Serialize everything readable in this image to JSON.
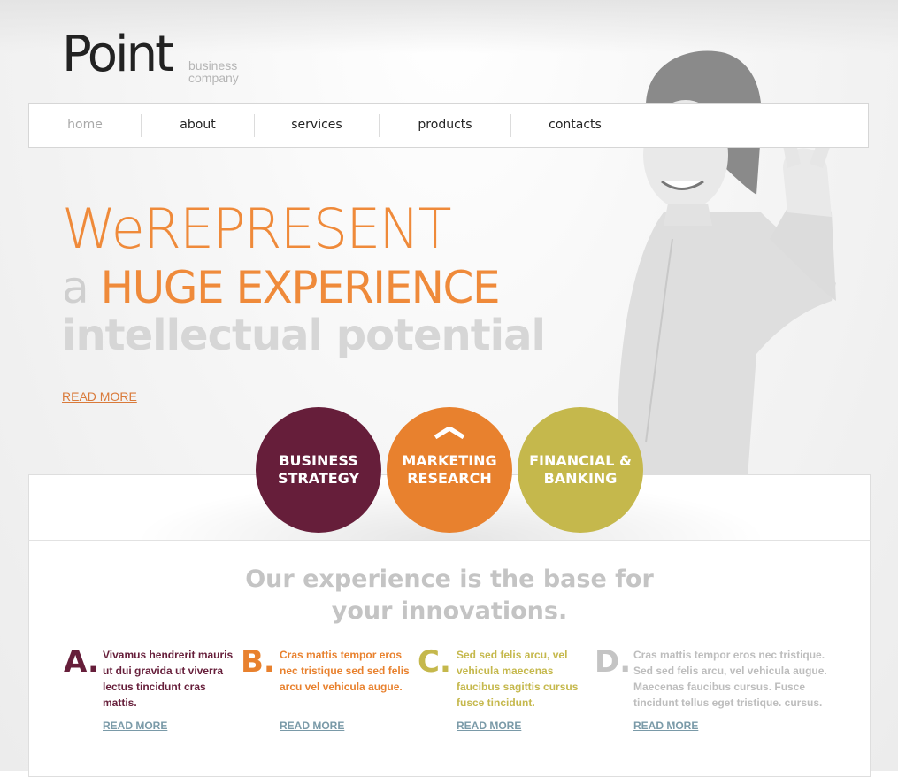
{
  "logo": {
    "word": "Point",
    "tag_line1": "business",
    "tag_line2": "company"
  },
  "nav": {
    "items": [
      "home",
      "about",
      "services",
      "products",
      "contacts"
    ],
    "active": "home"
  },
  "hero": {
    "line1": "WeREPRESENT",
    "line2_light": "a ",
    "line2_accent": "HUGE EXPERIENCE",
    "line3": "intellectual potential",
    "read_more": "READ MORE"
  },
  "circles": [
    {
      "line1": "BUSINESS",
      "line2": "STRATEGY",
      "color": "#661e3a"
    },
    {
      "line1": "MARKETING",
      "line2": "RESEARCH",
      "color": "#e8812e"
    },
    {
      "line1": "FINANCIAL &",
      "line2": "BANKING",
      "color": "#c5b84c"
    }
  ],
  "section": {
    "title_line1": "Our experience is the base for",
    "title_line2": "your innovations."
  },
  "columns": [
    {
      "letter": "A.",
      "text": "Vivamus hendrerit mauris ut dui gravida ut viverra lectus tincidunt cras mattis.",
      "more": "READ MORE",
      "color": "#661e3a"
    },
    {
      "letter": "B.",
      "text": "Cras mattis tempor eros nec tristique sed sed felis arcu vel vehicula augue.",
      "more": "READ MORE",
      "color": "#e8812e"
    },
    {
      "letter": "C.",
      "text": "Sed sed felis arcu, vel vehicula maecenas faucibus sagittis cursus fusce tincidunt.",
      "more": "READ MORE",
      "color": "#c5b84c"
    },
    {
      "letter": "D.",
      "text": "Cras mattis tempor eros nec tristique. Sed sed felis arcu, vel vehicula augue. Maecenas faucibus cursus. Fusce tincidunt tellus eget tristique. cursus.",
      "more": "READ MORE",
      "color": "#bdbdbd"
    }
  ]
}
